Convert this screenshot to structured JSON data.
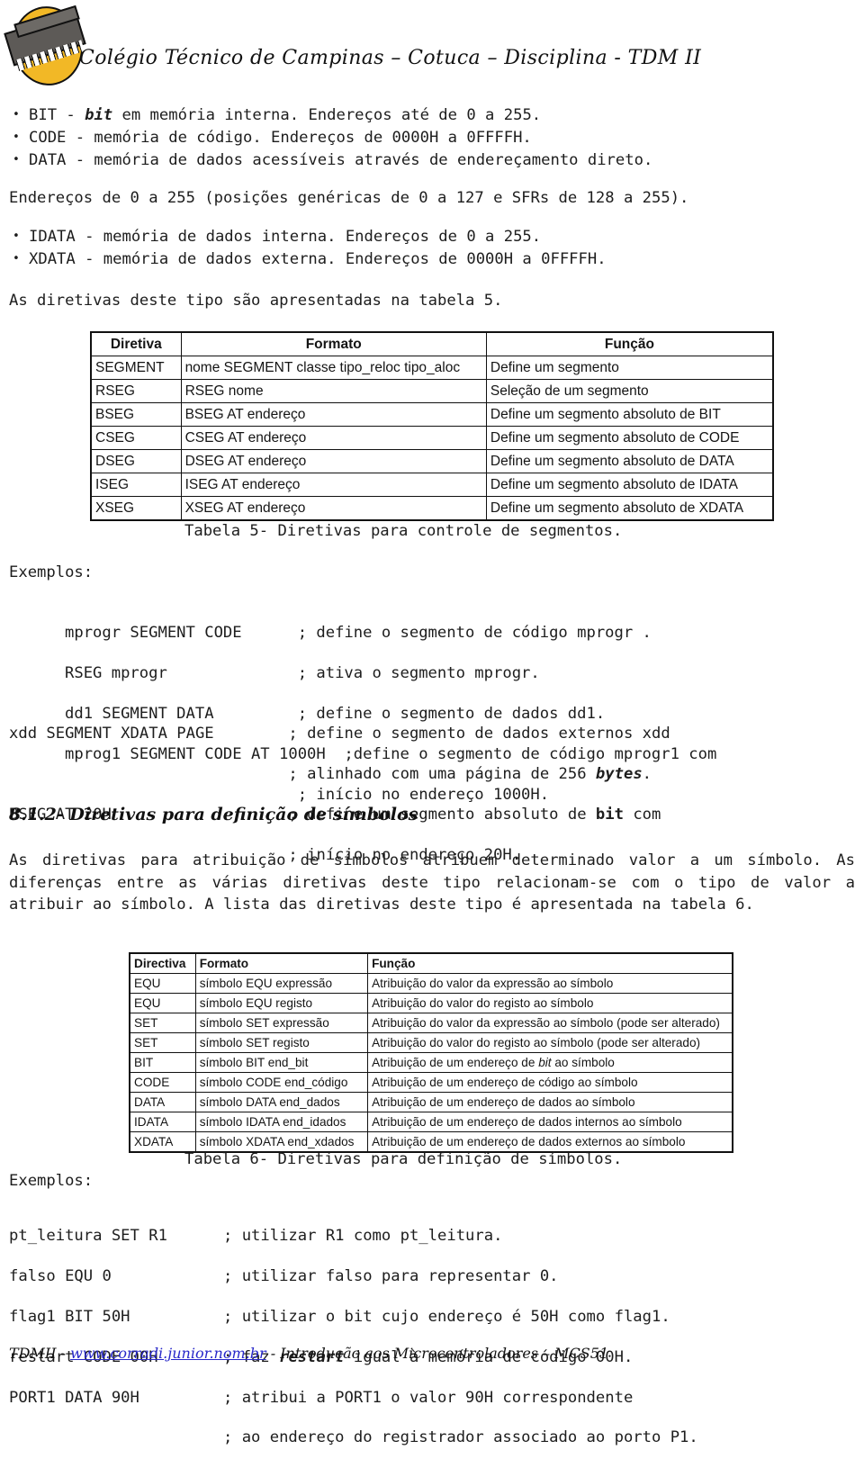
{
  "header": {
    "logo_name": "cotuca-chip-logo",
    "title": "Colégio Técnico de Campinas – Cotuca – Disciplina - TDM II"
  },
  "bullets_top": [
    {
      "pre": "BIT - ",
      "em": "bit",
      "post": " em memória interna. Endereços até de 0 a 255."
    },
    {
      "pre": "CODE - memória de código. Endereços de 0000H a 0FFFFH.",
      "em": "",
      "post": ""
    },
    {
      "pre": "DATA - memória de dados acessíveis através de endereçamento direto.",
      "em": "",
      "post": ""
    }
  ],
  "paragraph_addresses": "Endereços de 0 a 255 (posições genéricas de 0 a 127 e SFRs de 128 a 255).",
  "bullets_mid": [
    {
      "pre": "IDATA - memória de dados interna. Endereços de 0 a 255.",
      "em": "",
      "post": ""
    },
    {
      "pre": "XDATA - memória de dados externa. Endereços de 0000H a 0FFFFH.",
      "em": "",
      "post": ""
    }
  ],
  "paragraph_table5_intro": "As diretivas deste tipo são apresentadas na tabela 5.",
  "table5": {
    "headers": [
      "Diretiva",
      "Formato",
      "Função"
    ],
    "rows": [
      [
        "SEGMENT",
        "nome SEGMENT classe tipo_reloc tipo_aloc",
        "Define um segmento"
      ],
      [
        "RSEG",
        "RSEG nome",
        "Seleção de um segmento"
      ],
      [
        "BSEG",
        "BSEG AT endereço",
        "Define um segmento absoluto de BIT"
      ],
      [
        "CSEG",
        "CSEG AT endereço",
        "Define um segmento absoluto de CODE"
      ],
      [
        "DSEG",
        "DSEG AT endereço",
        "Define um segmento absoluto de DATA"
      ],
      [
        "ISEG",
        "ISEG AT endereço",
        "Define um segmento absoluto de IDATA"
      ],
      [
        "XSEG",
        "XSEG AT endereço",
        "Define um segmento absoluto de XDATA"
      ]
    ],
    "caption": "Tabela 5- Diretivas para controle de segmentos."
  },
  "examples_label_1": "Exemplos:",
  "code_block_1": {
    "lines": [
      {
        "indent": 72,
        "text": "mprogr SEGMENT CODE      ; define o segmento de código mprogr ."
      },
      {
        "indent": 72,
        "text": "RSEG mprogr              ; ativa o segmento mprogr."
      },
      {
        "indent": 72,
        "text": "dd1 SEGMENT DATA         ; define o segmento de dados dd1."
      },
      {
        "indent": 72,
        "text": "mprog1 SEGMENT CODE AT 1000H  ;define o segmento de código mprogr1 com"
      },
      {
        "indent": 72,
        "text": "                         ; início no endereço 1000H."
      }
    ],
    "lines2_pre": "xdd SEGMENT XDATA PAGE        ; define o segmento de dados externos xdd",
    "line_bytes_pre": "                              ; alinhado com uma página de 256 ",
    "line_bytes_em": "bytes",
    "line_bytes_post": ".",
    "line_bseg_pre": "BSEG AT 20H                   ; define um segmento absoluto de ",
    "line_bseg_em": "bit",
    "line_bseg_post": " com",
    "line_bseg2": "                              ; início no endereço 20H."
  },
  "section_heading": "8.1.2- Diretivas para definição de símbolos",
  "paragraph_symbols": "As diretivas para atribuição de símbolos atribuem determinado valor a um símbolo. As diferenças entre as várias diretivas deste tipo relacionam-se com o tipo de valor a atribuir ao símbolo. A lista das diretivas deste tipo é apresentada na tabela 6.",
  "table6": {
    "headers": [
      "Directiva",
      "Formato",
      "Função"
    ],
    "rows": [
      [
        "EQU",
        "símbolo EQU expressão",
        "Atribuição do valor da expressão ao símbolo"
      ],
      [
        "EQU",
        "símbolo EQU registo",
        "Atribuição do valor do registo ao símbolo"
      ],
      [
        "SET",
        "símbolo SET expressão",
        "Atribuição do valor da expressão ao símbolo (pode ser alterado)"
      ],
      [
        "SET",
        "símbolo SET registo",
        "Atribuição do valor do registo ao símbolo (pode ser alterado)"
      ],
      [
        "BIT",
        "símbolo BIT end_bit",
        "Atribuição de um endereço de bit ao símbolo"
      ],
      [
        "CODE",
        "símbolo CODE end_código",
        "Atribuição de um endereço de código ao símbolo"
      ],
      [
        "DATA",
        "símbolo DATA end_dados",
        "Atribuição de um endereço de dados ao símbolo"
      ],
      [
        "IDATA",
        "símbolo IDATA end_idados",
        "Atribuição de um endereço de dados internos ao símbolo"
      ],
      [
        "XDATA",
        "símbolo XDATA end_xdados",
        "Atribuição de um endereço de dados externos ao símbolo"
      ]
    ],
    "caption": "Tabela 6- Diretivas para definição de símbolos."
  },
  "examples_label_2": "Exemplos:",
  "code_block_2": {
    "line_1": "pt_leitura SET R1      ; utilizar R1 como pt_leitura.",
    "line_2": "falso EQU 0            ; utilizar falso para representar 0.",
    "line_3": "flag1 BIT 50H          ; utilizar o bit cujo endereço é 50H como flag1.",
    "line_4_pre": "restart CODE 00H       ; faz ",
    "line_4_em": "restart",
    "line_4_post": " igual à memória de código 00H.",
    "line_5": "PORT1 DATA 90H         ; atribui a PORT1 o valor 90H correspondente",
    "line_6": "                       ; ao endereço do registrador associado ao porto P1."
  },
  "footer": {
    "prefix": "TDMII - ",
    "link": "www.corradi.junior.nom.br",
    "suffix": " - Introdução aos Microcontroladores – MCS51"
  }
}
